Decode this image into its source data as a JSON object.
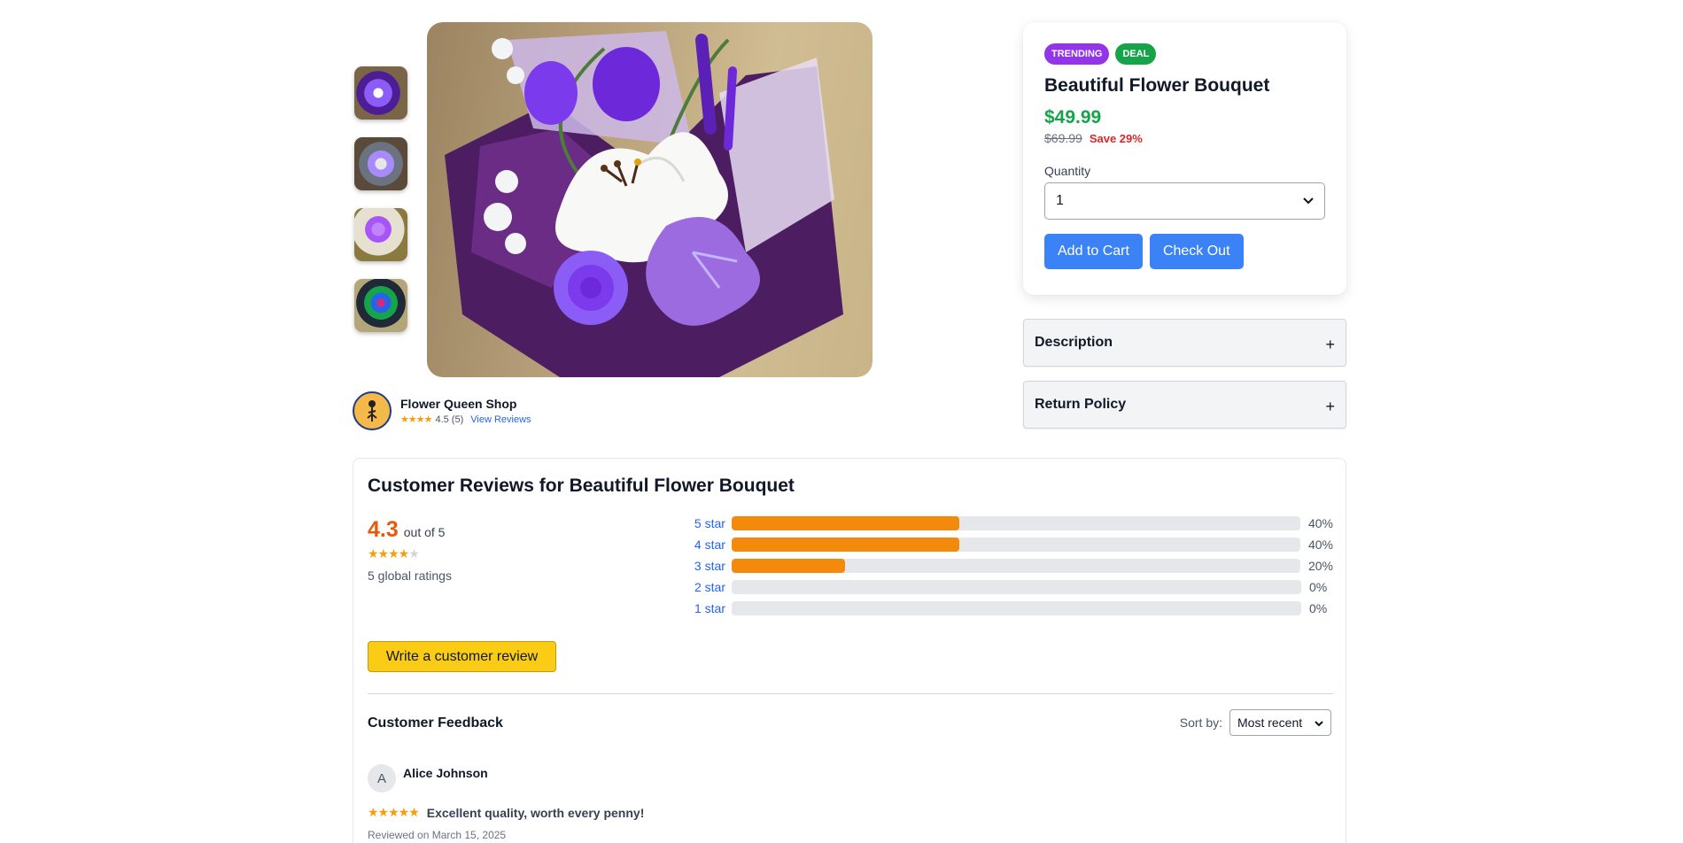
{
  "product": {
    "badges": [
      "TRENDING",
      "DEAL"
    ],
    "title": "Beautiful Flower Bouquet",
    "price": "$49.99",
    "old_price": "$69.99",
    "save": "Save 29%",
    "quantity_label": "Quantity",
    "quantity_value": "1",
    "add_to_cart": "Add to Cart",
    "check_out": "Check Out"
  },
  "accordions": [
    {
      "title": "Description",
      "toggle": "+"
    },
    {
      "title": "Return Policy",
      "toggle": "+"
    }
  ],
  "shop": {
    "name": "Flower Queen Shop",
    "stars": "★★★★",
    "rating": "4.5 (5)",
    "view_reviews": "View Reviews"
  },
  "reviews": {
    "title": "Customer Reviews for Beautiful Flower Bouquet",
    "average": "4.3",
    "out_of": "out of 5",
    "stars_filled": "★★★★",
    "stars_empty": "★",
    "global_ratings": "5 global ratings",
    "distribution": [
      {
        "label": "5 star",
        "percent": 40,
        "percent_text": "40%"
      },
      {
        "label": "4 star",
        "percent": 40,
        "percent_text": "40%"
      },
      {
        "label": "3 star",
        "percent": 20,
        "percent_text": "20%"
      },
      {
        "label": "2 star",
        "percent": 0,
        "percent_text": "0%"
      },
      {
        "label": "1 star",
        "percent": 0,
        "percent_text": "0%"
      }
    ],
    "write_review": "Write a customer review",
    "feedback_title": "Customer Feedback",
    "sort_label": "Sort by:",
    "sort_value": "Most recent",
    "items": [
      {
        "initial": "A",
        "name": "Alice Johnson",
        "stars": "★★★★★",
        "headline": "Excellent quality, worth every penny!",
        "date": "Reviewed on March 15, 2025"
      }
    ]
  },
  "colors": {
    "accent_blue": "#3b82f6",
    "price_green": "#16a34a",
    "save_red": "#dc2626",
    "bar_orange": "#f48a0c",
    "rating_orange": "#ea580c",
    "trending_purple": "#9333ea",
    "write_review_yellow": "#facc15"
  },
  "icons": {
    "select_chevron": "chevron-down-icon",
    "accordion_toggle": "plus-icon",
    "shop_logo": "shop-logo-icon",
    "star": "star-icon"
  }
}
